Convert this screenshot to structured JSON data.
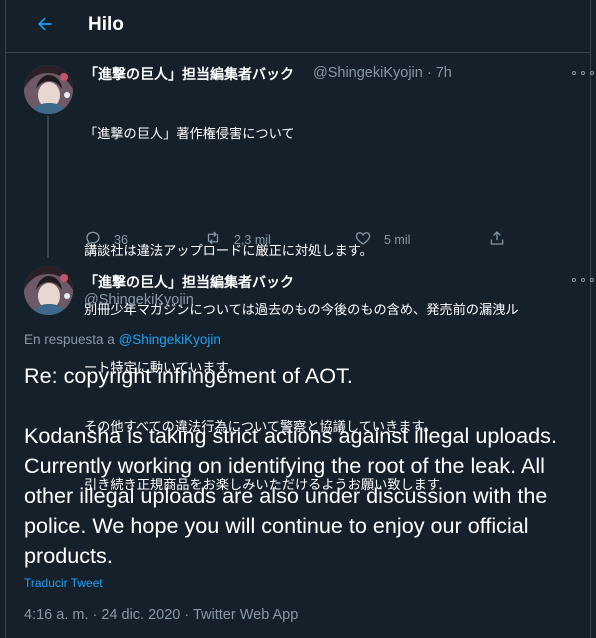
{
  "header": {
    "title": "Hilo"
  },
  "tweet1": {
    "display_name": "「進撃の巨人」担当編集者バック",
    "handle": "@ShingekiKyojin",
    "time": "7h",
    "text_lines": [
      "「進撃の巨人」著作権侵害について",
      "",
      "講談社は違法アップロードに厳正に対処します。",
      "別冊少年マガジンについては過去のもの今後のもの含め、発売前の漏洩ル",
      "ート特定に動いています。",
      "その他すべての違法行為について警察と協議していきます。",
      "引き続き正規商品をお楽しみいただけるようお願い致します"
    ],
    "replies": "36",
    "retweets": "2,3 mil",
    "likes": "5 mil"
  },
  "tweet2": {
    "display_name": "「進撃の巨人」担当編集者バック",
    "handle": "@ShingekiKyojin",
    "reply_prefix": "En respuesta a",
    "reply_mention": "@ShingekiKyojin",
    "text_title": "Re: copyright infringement of AOT.",
    "text_body": "Kodansha is taking strict actions against illegal uploads. Currently working on identifying the root of the leak. All other illegal uploads are also under discussion with the police. We hope you will continue to enjoy our official products.",
    "translate_label": "Traducir Tweet",
    "timestamp": "4:16 a. m. · 24 dic. 2020 · Twitter Web App"
  },
  "colors": {
    "background": "#15202b",
    "border": "#38444d",
    "secondary_text": "#8899a6",
    "accent": "#1da1f2"
  },
  "icons": {
    "back": "arrow-left-icon",
    "more": "more-dots-icon",
    "reply": "comment-icon",
    "retweet": "retweet-icon",
    "like": "heart-icon",
    "share": "share-icon"
  }
}
